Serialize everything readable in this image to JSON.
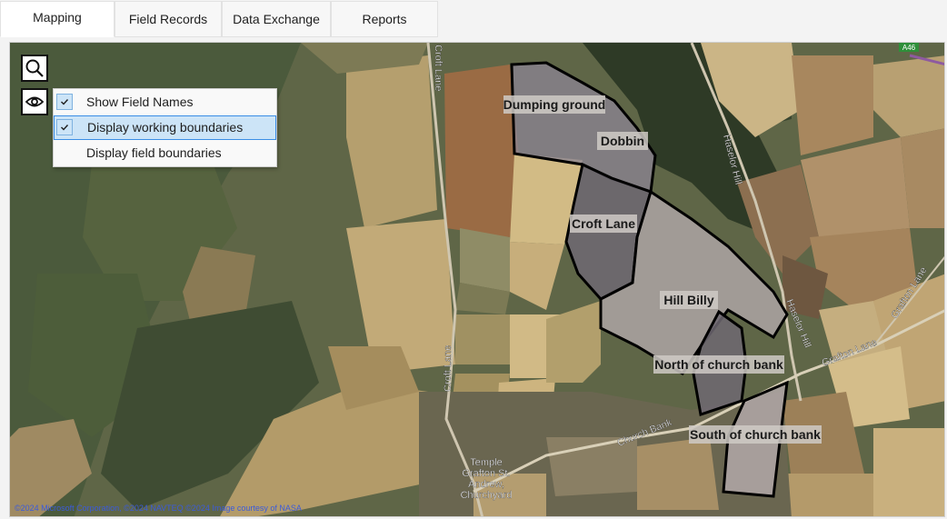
{
  "tabs": [
    {
      "label": "Mapping",
      "active": true
    },
    {
      "label": "Field Records",
      "active": false
    },
    {
      "label": "Data Exchange",
      "active": false
    },
    {
      "label": "Reports",
      "active": false
    }
  ],
  "toolbar": {
    "search_icon": "search-icon",
    "view_icon": "eye-icon"
  },
  "menu": {
    "items": [
      {
        "label": "Show Field Names",
        "checked": true
      },
      {
        "label": "Display working boundaries",
        "checked": true,
        "highlighted": true
      },
      {
        "label": "Display field boundaries",
        "checked": false
      }
    ]
  },
  "map": {
    "fields": [
      {
        "name": "Dumping ground"
      },
      {
        "name": "Dobbin"
      },
      {
        "name": "Croft Lane"
      },
      {
        "name": "Hill Billy"
      },
      {
        "name": "North of church bank"
      },
      {
        "name": "South of church bank"
      }
    ],
    "roads": {
      "croft_lane_top": "Croft Lane",
      "croft_lane_mid": "Croft Lane",
      "haselor_hill_top": "Haselor Hill",
      "haselor_hill_mid": "Haselor Hill",
      "grafton_lane_1": "Grafton Lane",
      "grafton_lane_2": "Grafton Lane",
      "church_bank": "Church Bank",
      "road_badge": "A46"
    },
    "place": {
      "line1": "Temple",
      "line2": "Grafton St.",
      "line3": "Andrew,",
      "line4": "Churchyard"
    },
    "attribution": "©2024 Microsoft Corporation, ©2024 NAVTEQ ©2024 Image courtesy of NASA"
  },
  "colors": {
    "boundary": "#000000",
    "field_fill": "#8a8492",
    "menu_highlight": "#cce4f7"
  }
}
